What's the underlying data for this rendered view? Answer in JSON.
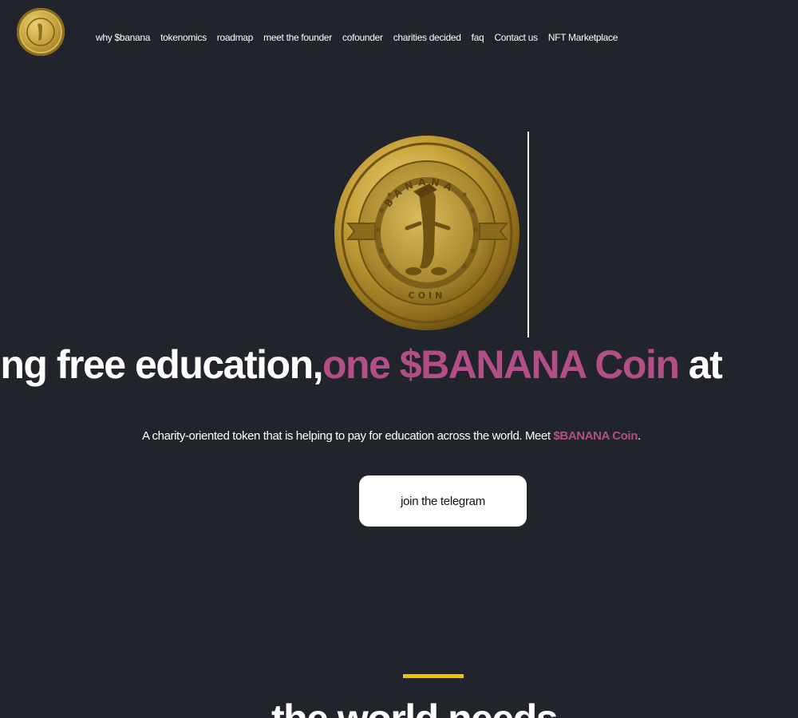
{
  "nav": {
    "items": [
      {
        "label": "why $banana"
      },
      {
        "label": "tokenomics"
      },
      {
        "label": "roadmap"
      },
      {
        "label": "meet the founder"
      },
      {
        "label": "cofounder"
      },
      {
        "label": "charities decided"
      },
      {
        "label": "faq"
      },
      {
        "label": "Contact us"
      },
      {
        "label": "NFT Marketplace"
      }
    ]
  },
  "hero": {
    "coin_top_text": "BANANA",
    "coin_bottom_text": "COIN",
    "headline_part1": "ing free education,",
    "headline_part2": "one $BANANA Coin",
    "headline_part3": " at",
    "sub_text": "A charity-oriented token that is helping to pay for education across the world. Meet ",
    "sub_highlight": "$BANANA Coin",
    "sub_end": ".",
    "cta_label": "join the telegram"
  },
  "next_section": {
    "title": "the world needs"
  },
  "colors": {
    "background": "#22242b",
    "accent_pink": "#b24f86",
    "divider_yellow": "#f4c300",
    "gold": "#c8a43e"
  }
}
